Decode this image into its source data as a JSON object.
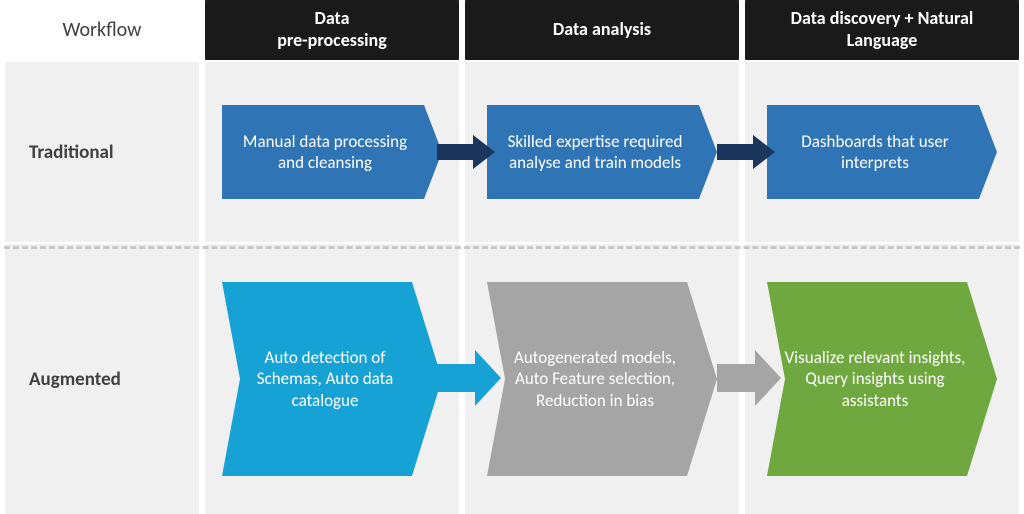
{
  "headers": {
    "workflow": "Workflow",
    "pre": "Data\npre-processing",
    "analysis": "Data analysis",
    "discovery": "Data discovery + Natural Language"
  },
  "rows": {
    "traditional": {
      "label": "Traditional",
      "pre": "Manual data processing and cleansing",
      "analysis": "Skilled expertise required analyse and train models",
      "discovery": "Dashboards that user interprets"
    },
    "augmented": {
      "label": "Augmented",
      "pre": "Auto detection of Schemas, Auto data catalogue",
      "analysis": "Autogenerated models, Auto Feature selection, Reduction in bias",
      "discovery": "Visualize relevant insights, Query insights using assistants"
    }
  },
  "colors": {
    "black": "#1a1a1a",
    "blue": "#2f74b5",
    "cyan": "#17a2d6",
    "gray": "#a5a5a5",
    "green": "#6fa83e",
    "darknavy": "#1a365d"
  }
}
